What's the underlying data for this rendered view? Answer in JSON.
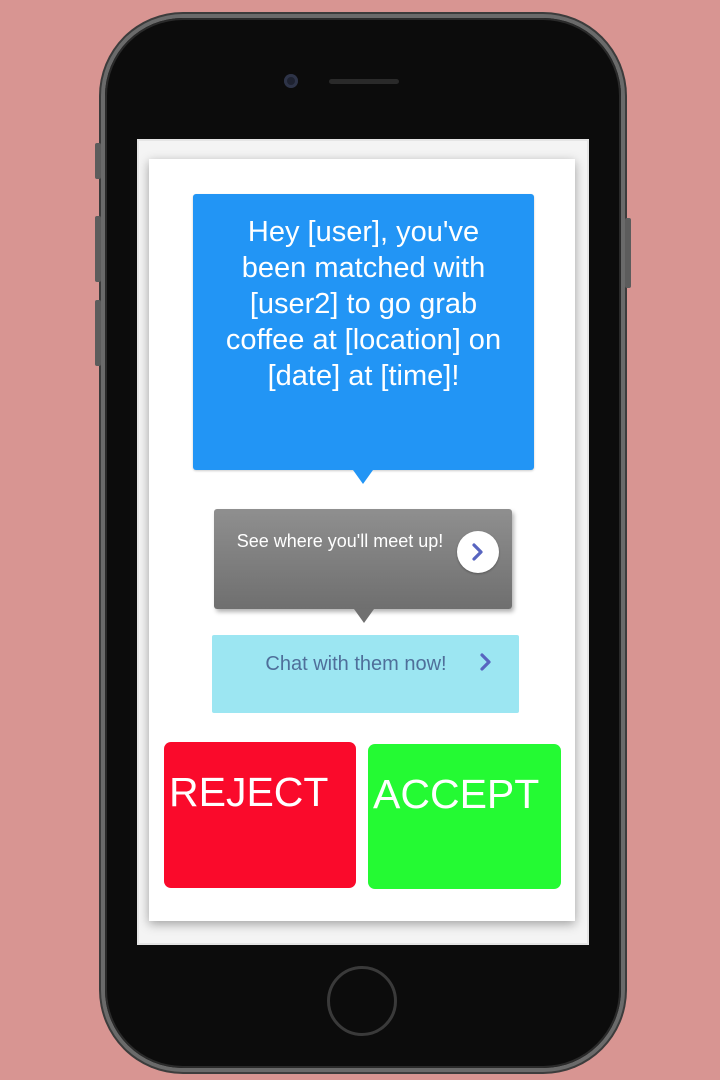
{
  "match_message": {
    "text": "Hey [user], you've been matched with [user2] to go grab coffee at [location] on [date] at [time]!"
  },
  "map_prompt": {
    "label": "See where you'll meet up!",
    "icon": "chevron-right-icon"
  },
  "chat_prompt": {
    "label": "Chat with them now!",
    "icon": "chevron-right-icon"
  },
  "actions": {
    "reject_label": "REJECT",
    "accept_label": "ACCEPT"
  },
  "colors": {
    "background": "#D89592",
    "message_bubble": "#2295F5",
    "map_bubble": "#7F7F7F",
    "chat_button": "#9CE6F2",
    "reject": "#FA0A2B",
    "accept": "#24FA33",
    "chevron": "#5865C0"
  }
}
